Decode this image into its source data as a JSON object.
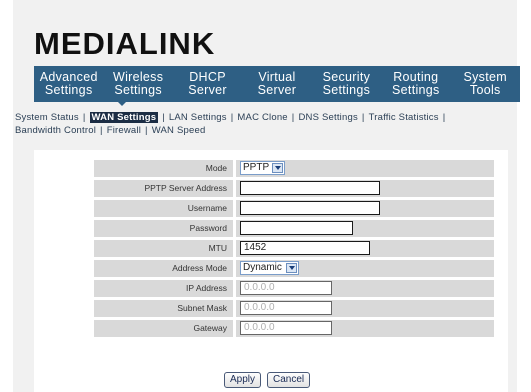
{
  "brand": {
    "name": "MEDIALINK"
  },
  "nav": [
    {
      "line1": "Advanced",
      "line2": "Settings"
    },
    {
      "line1": "Wireless",
      "line2": "Settings"
    },
    {
      "line1": "DHCP",
      "line2": "Server"
    },
    {
      "line1": "Virtual",
      "line2": "Server"
    },
    {
      "line1": "Security",
      "line2": "Settings"
    },
    {
      "line1": "Routing",
      "line2": "Settings"
    },
    {
      "line1": "System",
      "line2": "Tools"
    }
  ],
  "subnav": {
    "system_status": "System Status",
    "wan_settings": "WAN Settings",
    "lan_settings": "LAN Settings",
    "mac_clone": "MAC Clone",
    "dns_settings": "DNS Settings",
    "traffic_statistics": "Traffic Statistics",
    "bandwidth_control": "Bandwidth Control",
    "firewall": "Firewall",
    "wan_speed": "WAN Speed",
    "separator": "|"
  },
  "form": {
    "mode": {
      "label": "Mode",
      "value": "PPTP"
    },
    "server": {
      "label": "PPTP Server Address",
      "value": ""
    },
    "username": {
      "label": "Username",
      "value": ""
    },
    "password": {
      "label": "Password",
      "value": ""
    },
    "mtu": {
      "label": "MTU",
      "value": "1452"
    },
    "address_mode": {
      "label": "Address Mode",
      "value": "Dynamic"
    },
    "ip": {
      "label": "IP Address",
      "value": "0.0.0.0"
    },
    "subnet": {
      "label": "Subnet Mask",
      "value": "0.0.0.0"
    },
    "gateway": {
      "label": "Gateway",
      "value": "0.0.0.0"
    }
  },
  "buttons": {
    "apply": "Apply",
    "cancel": "Cancel"
  },
  "colors": {
    "nav_bg": "#2e5f84",
    "active_tab_bg": "#1c2d44",
    "row_bg": "#d9d9d9",
    "page_bg": "#f1f1f1"
  }
}
